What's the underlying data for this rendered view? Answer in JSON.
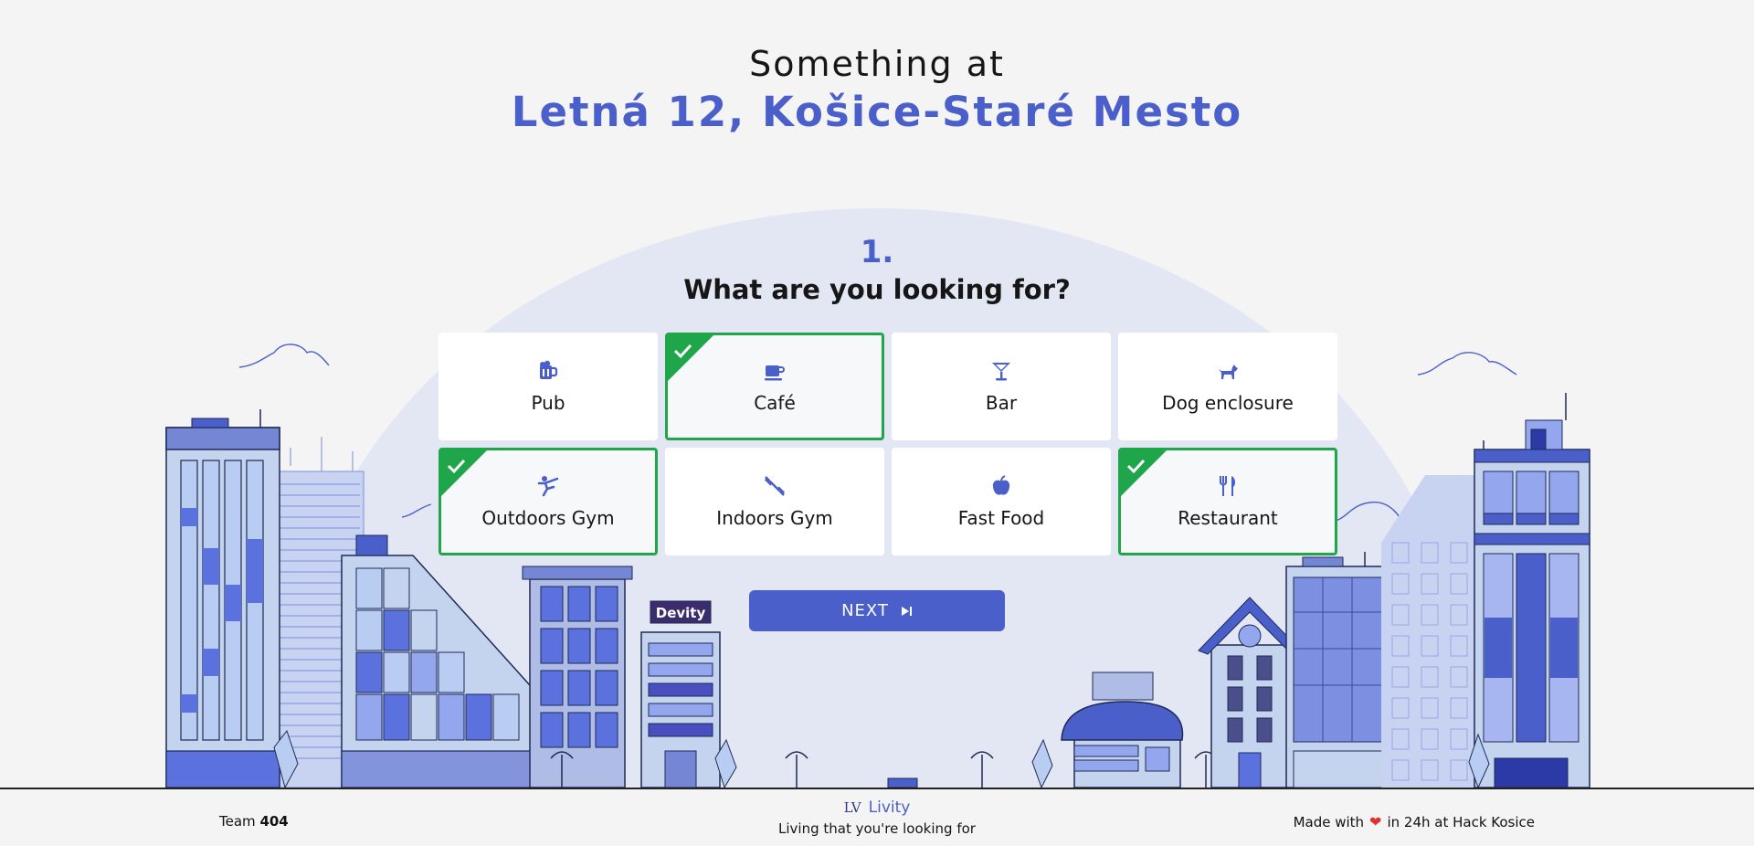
{
  "header": {
    "pre_title": "Something at",
    "address": "Letná 12, Košice-Staré Mesto"
  },
  "step": {
    "number": "1.",
    "question": "What are you looking for?"
  },
  "options": [
    {
      "label": "Pub",
      "icon": "beer-mug-icon",
      "selected": false
    },
    {
      "label": "Café",
      "icon": "coffee-cup-icon",
      "selected": true
    },
    {
      "label": "Bar",
      "icon": "cocktail-glass-icon",
      "selected": false
    },
    {
      "label": "Dog enclosure",
      "icon": "dog-icon",
      "selected": false
    },
    {
      "label": "Outdoors Gym",
      "icon": "exercise-person-icon",
      "selected": true
    },
    {
      "label": "Indoors Gym",
      "icon": "dumbbell-icon",
      "selected": false
    },
    {
      "label": "Fast Food",
      "icon": "apple-icon",
      "selected": false
    },
    {
      "label": "Restaurant",
      "icon": "fork-knife-icon",
      "selected": true
    }
  ],
  "next_button": {
    "label": "NEXT",
    "icon": "skip-next-icon"
  },
  "scene": {
    "sign_text": "Devity"
  },
  "footer": {
    "team_prefix": "Team",
    "team_number": "404",
    "brand_mark": "LV",
    "brand_name": "Livity",
    "tagline": "Living that you're looking for",
    "made_prefix": "Made with",
    "made_suffix": "in 24h at Hack Kosice"
  },
  "colors": {
    "accent": "#4a5fc9",
    "selected_border": "#1fa64b",
    "background": "#f4f4f5",
    "arch": "#e2e7f3"
  }
}
